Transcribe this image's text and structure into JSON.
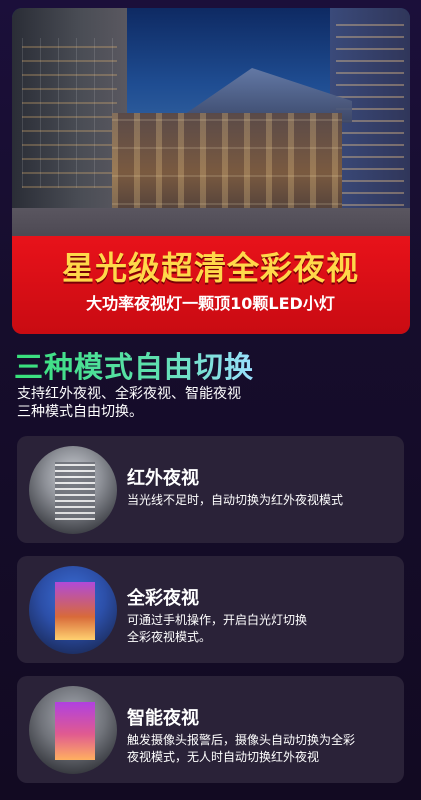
{
  "banner": {
    "title": "星光级超清全彩夜视",
    "subtitle": "大功率夜视灯一颗顶10颗LED小灯"
  },
  "section": {
    "title": "三种模式自由切换",
    "description_lines": [
      "支持红外夜视、全彩夜视、智能夜视",
      "三种模式自由切换。"
    ]
  },
  "cards": [
    {
      "title": "红外夜视",
      "desc_lines": [
        "当光线不足时，自动切换为红外夜视模式"
      ]
    },
    {
      "title": "全彩夜视",
      "desc_lines": [
        "可通过手机操作，开启白光灯切换",
        "全彩夜视模式。"
      ]
    },
    {
      "title": "智能夜视",
      "desc_lines": [
        "触发摄像头报警后，摄像头自动切换为全彩",
        "夜视模式，无人时自动切换红外夜视"
      ]
    }
  ],
  "colors": {
    "banner_red": "#e8121a",
    "banner_title_yellow": "#ffd84a",
    "section_title_green": "#37e07a",
    "card_bg": "#2a2238"
  }
}
